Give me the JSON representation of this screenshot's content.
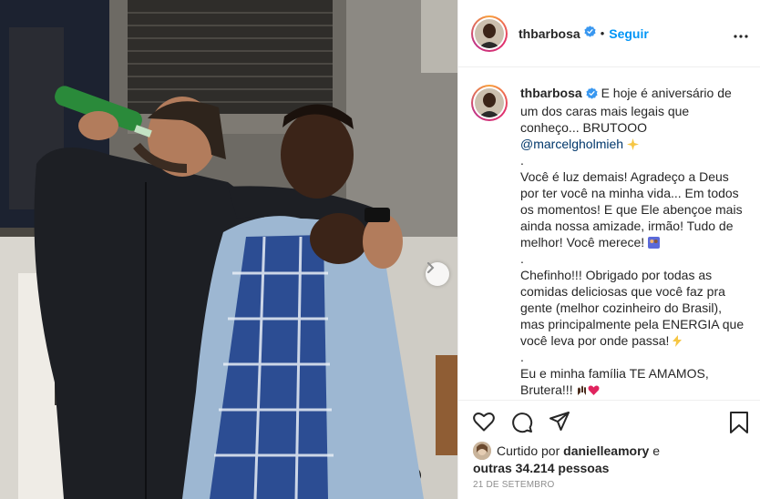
{
  "post": {
    "username": "thbarbosa",
    "separator": "•",
    "follow_label": "Seguir",
    "more_icon": "more-options-icon"
  },
  "caption": {
    "username": "thbarbosa",
    "line1": "E hoje é aniversário de um dos caras mais legais que conheço... BRUTOOO",
    "mention": "@marcelgholmieh",
    "para1": "\n.\nVocê é luz demais! Agradeço a Deus por ter você na minha vida... Em todos os momentos! E que Ele abençoe mais ainda nossa amizade, irmão! Tudo de melhor! Você merece! ",
    "para2": "\n.\nChefinho!!! Obrigado por todas as comidas deliciosas que você faz pra gente (melhor cozinheiro do Brasil), mas principalmente pela ENERGIA que você leva por onde passa! ",
    "para3": "\n.\nEu e minha família TE AMAMOS, Brutera!!! "
  },
  "likes": {
    "prefix": "Curtido por",
    "liker": "danielleamory",
    "joiner": "e",
    "others": "outras 34.214 pessoas"
  },
  "date": "21 de setembro",
  "colors": {
    "accent": "#0095f6",
    "mention": "#00376b",
    "muted": "#8e8e8e"
  },
  "icons": [
    "heart-icon",
    "comment-icon",
    "share-icon",
    "bookmark-icon",
    "verified-icon",
    "carousel-next-icon"
  ]
}
